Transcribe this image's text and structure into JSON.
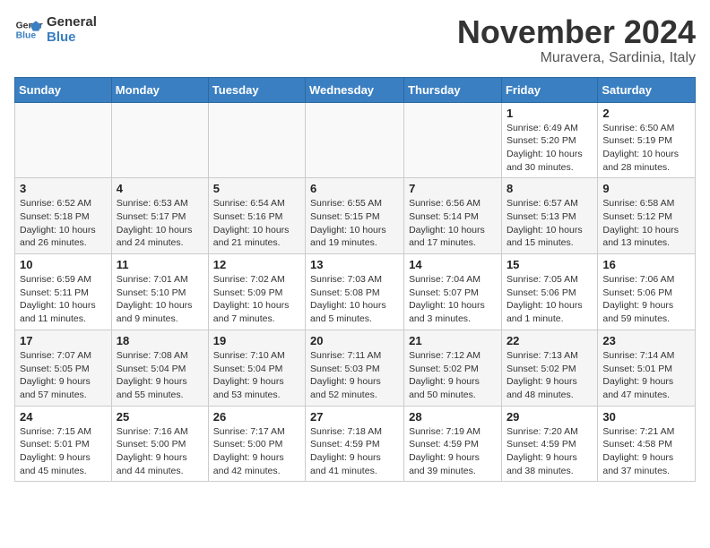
{
  "logo": {
    "line1": "General",
    "line2": "Blue"
  },
  "title": "November 2024",
  "location": "Muravera, Sardinia, Italy",
  "weekdays": [
    "Sunday",
    "Monday",
    "Tuesday",
    "Wednesday",
    "Thursday",
    "Friday",
    "Saturday"
  ],
  "weeks": [
    [
      {
        "day": "",
        "detail": ""
      },
      {
        "day": "",
        "detail": ""
      },
      {
        "day": "",
        "detail": ""
      },
      {
        "day": "",
        "detail": ""
      },
      {
        "day": "",
        "detail": ""
      },
      {
        "day": "1",
        "detail": "Sunrise: 6:49 AM\nSunset: 5:20 PM\nDaylight: 10 hours and 30 minutes."
      },
      {
        "day": "2",
        "detail": "Sunrise: 6:50 AM\nSunset: 5:19 PM\nDaylight: 10 hours and 28 minutes."
      }
    ],
    [
      {
        "day": "3",
        "detail": "Sunrise: 6:52 AM\nSunset: 5:18 PM\nDaylight: 10 hours and 26 minutes."
      },
      {
        "day": "4",
        "detail": "Sunrise: 6:53 AM\nSunset: 5:17 PM\nDaylight: 10 hours and 24 minutes."
      },
      {
        "day": "5",
        "detail": "Sunrise: 6:54 AM\nSunset: 5:16 PM\nDaylight: 10 hours and 21 minutes."
      },
      {
        "day": "6",
        "detail": "Sunrise: 6:55 AM\nSunset: 5:15 PM\nDaylight: 10 hours and 19 minutes."
      },
      {
        "day": "7",
        "detail": "Sunrise: 6:56 AM\nSunset: 5:14 PM\nDaylight: 10 hours and 17 minutes."
      },
      {
        "day": "8",
        "detail": "Sunrise: 6:57 AM\nSunset: 5:13 PM\nDaylight: 10 hours and 15 minutes."
      },
      {
        "day": "9",
        "detail": "Sunrise: 6:58 AM\nSunset: 5:12 PM\nDaylight: 10 hours and 13 minutes."
      }
    ],
    [
      {
        "day": "10",
        "detail": "Sunrise: 6:59 AM\nSunset: 5:11 PM\nDaylight: 10 hours and 11 minutes."
      },
      {
        "day": "11",
        "detail": "Sunrise: 7:01 AM\nSunset: 5:10 PM\nDaylight: 10 hours and 9 minutes."
      },
      {
        "day": "12",
        "detail": "Sunrise: 7:02 AM\nSunset: 5:09 PM\nDaylight: 10 hours and 7 minutes."
      },
      {
        "day": "13",
        "detail": "Sunrise: 7:03 AM\nSunset: 5:08 PM\nDaylight: 10 hours and 5 minutes."
      },
      {
        "day": "14",
        "detail": "Sunrise: 7:04 AM\nSunset: 5:07 PM\nDaylight: 10 hours and 3 minutes."
      },
      {
        "day": "15",
        "detail": "Sunrise: 7:05 AM\nSunset: 5:06 PM\nDaylight: 10 hours and 1 minute."
      },
      {
        "day": "16",
        "detail": "Sunrise: 7:06 AM\nSunset: 5:06 PM\nDaylight: 9 hours and 59 minutes."
      }
    ],
    [
      {
        "day": "17",
        "detail": "Sunrise: 7:07 AM\nSunset: 5:05 PM\nDaylight: 9 hours and 57 minutes."
      },
      {
        "day": "18",
        "detail": "Sunrise: 7:08 AM\nSunset: 5:04 PM\nDaylight: 9 hours and 55 minutes."
      },
      {
        "day": "19",
        "detail": "Sunrise: 7:10 AM\nSunset: 5:04 PM\nDaylight: 9 hours and 53 minutes."
      },
      {
        "day": "20",
        "detail": "Sunrise: 7:11 AM\nSunset: 5:03 PM\nDaylight: 9 hours and 52 minutes."
      },
      {
        "day": "21",
        "detail": "Sunrise: 7:12 AM\nSunset: 5:02 PM\nDaylight: 9 hours and 50 minutes."
      },
      {
        "day": "22",
        "detail": "Sunrise: 7:13 AM\nSunset: 5:02 PM\nDaylight: 9 hours and 48 minutes."
      },
      {
        "day": "23",
        "detail": "Sunrise: 7:14 AM\nSunset: 5:01 PM\nDaylight: 9 hours and 47 minutes."
      }
    ],
    [
      {
        "day": "24",
        "detail": "Sunrise: 7:15 AM\nSunset: 5:01 PM\nDaylight: 9 hours and 45 minutes."
      },
      {
        "day": "25",
        "detail": "Sunrise: 7:16 AM\nSunset: 5:00 PM\nDaylight: 9 hours and 44 minutes."
      },
      {
        "day": "26",
        "detail": "Sunrise: 7:17 AM\nSunset: 5:00 PM\nDaylight: 9 hours and 42 minutes."
      },
      {
        "day": "27",
        "detail": "Sunrise: 7:18 AM\nSunset: 4:59 PM\nDaylight: 9 hours and 41 minutes."
      },
      {
        "day": "28",
        "detail": "Sunrise: 7:19 AM\nSunset: 4:59 PM\nDaylight: 9 hours and 39 minutes."
      },
      {
        "day": "29",
        "detail": "Sunrise: 7:20 AM\nSunset: 4:59 PM\nDaylight: 9 hours and 38 minutes."
      },
      {
        "day": "30",
        "detail": "Sunrise: 7:21 AM\nSunset: 4:58 PM\nDaylight: 9 hours and 37 minutes."
      }
    ]
  ]
}
